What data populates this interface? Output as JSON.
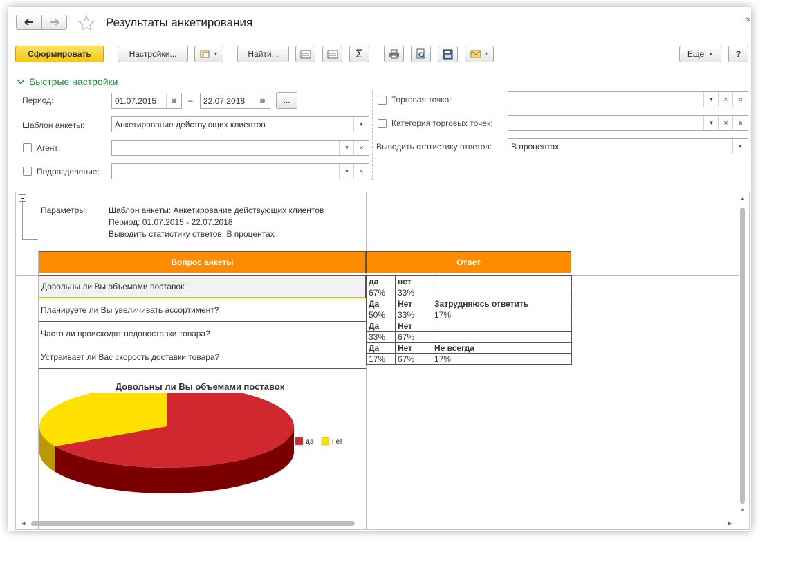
{
  "window": {
    "title": "Результаты анкетирования",
    "close_glyph": "×"
  },
  "toolbar": {
    "generate_label": "Сформировать",
    "settings_label": "Настройки...",
    "find_label": "Найти...",
    "sum_glyph": "Σ",
    "more_label": "Еще",
    "help_label": "?"
  },
  "quick_settings": {
    "title": "Быстрые настройки",
    "period_label": "Период:",
    "period_from": "01.07.2015",
    "period_dash": "–",
    "period_to": "22.07.2018",
    "period_more": "...",
    "template_label": "Шаблон анкеты:",
    "template_value": "Анкетирование действующих клиентов",
    "agent_label": "Агент:",
    "agent_value": "",
    "division_label": "Подразделение:",
    "division_value": "",
    "outlet_label": "Торговая точка:",
    "outlet_value": "",
    "outlet_category_label": "Категория торговых точек:",
    "outlet_category_value": "",
    "stats_label": "Выводить статистику ответов:",
    "stats_value": "В процентах"
  },
  "report": {
    "params_label": "Параметры:",
    "params_lines": [
      "Шаблон анкеты: Анкетирование действующих клиентов",
      "Период: 01.07.2015 - 22.07.2018",
      "Выводить статистику ответов: В процентах"
    ],
    "header_question": "Вопрос анкеты",
    "header_answer": "Ответ",
    "rows": [
      {
        "question": "Довольны ли Вы объемами поставок",
        "answers": [
          "да",
          "нет",
          ""
        ],
        "values": [
          "67%",
          "33%",
          ""
        ]
      },
      {
        "question": "Планируете ли Вы увеличивать ассортимент?",
        "answers": [
          "Да",
          "Нет",
          "Затрудняюсь ответить"
        ],
        "values": [
          "50%",
          "33%",
          "17%"
        ]
      },
      {
        "question": "Часто ли происходят недопоставки товара?",
        "answers": [
          "Да",
          "Нет",
          ""
        ],
        "values": [
          "33%",
          "67%",
          ""
        ]
      },
      {
        "question": "Устраивает ли Вас скорость доставки товара?",
        "answers": [
          "Да",
          "Нет",
          "Не всегда"
        ],
        "values": [
          "17%",
          "67%",
          "17%"
        ]
      }
    ]
  },
  "chart_data": {
    "type": "pie",
    "title": "Довольны ли Вы объемами поставок",
    "categories": [
      "да",
      "нет"
    ],
    "values": [
      67,
      33
    ],
    "colors": [
      "#d0282e",
      "#ffe000"
    ],
    "dark_colors": [
      "#7a0000",
      "#b89a00"
    ],
    "legend_position": "right"
  }
}
